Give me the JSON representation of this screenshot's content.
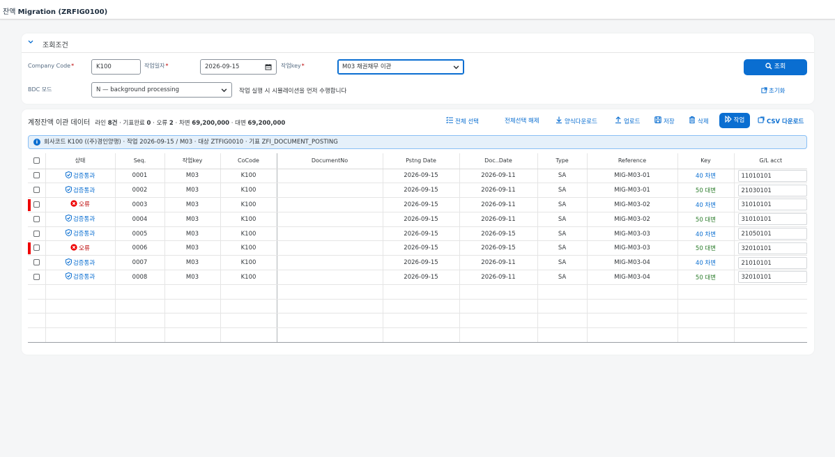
{
  "app": {
    "title_prefix": "잔액",
    "title_main": "Migration (ZRFIG0100)"
  },
  "filter": {
    "header": "조회조건",
    "company_code_label": "Company Code",
    "company_code_value": "K100",
    "date_label": "작업일자",
    "date_value": "2026-09-15",
    "key_label": "작업key",
    "key_value": "M03 채권채무 이관",
    "bdc_label": "BDC 모드",
    "bdc_value": "N — background processing",
    "hint": "작업 실행 시 시뮬레이션을 먼저 수행합니다",
    "search_label": "조회",
    "reset_label": "초기화"
  },
  "table": {
    "title": "계정잔액 이관 데이터",
    "summary": {
      "lines_label": "라인",
      "lines_value": "8건",
      "posted_label": "· 기표완료",
      "posted_value": "0",
      "error_label": "· 오류",
      "error_value": "2",
      "debit_label": "· 차변",
      "debit_value": "69,200,000",
      "credit_label": "· 대변",
      "credit_value": "69,200,000"
    },
    "toolbar": {
      "select_all": "전체 선택",
      "deselect_all": "전체선택 해제",
      "template_download": "양식다운로드",
      "upload": "업로드",
      "save": "저장",
      "delete": "삭제",
      "run": "작업",
      "csv_download": "CSV 다운로드"
    },
    "info": "회사코드 K100 ((주)경인양행) · 작업 2026-09-15 / M03 · 대상 ZTFIG0010 · 기표 ZFI_DOCUMENT_POSTING",
    "columns": [
      "상태",
      "Seq.",
      "작업key",
      "CoCode",
      "DocumentNo",
      "Pstng Date",
      "Doc..Date",
      "Type",
      "Reference",
      "Key",
      "G/L acct"
    ],
    "rows": [
      {
        "status": "검증통과",
        "ok": true,
        "seq": "0001",
        "key": "M03",
        "cocode": "K100",
        "docno": "",
        "pdate": "2026-09-15",
        "ddate": "2026-09-11",
        "type": "SA",
        "ref": "MIG-M03-01",
        "pkey": "40 차변",
        "debit": true,
        "gl": "11010101"
      },
      {
        "status": "검증통과",
        "ok": true,
        "seq": "0002",
        "key": "M03",
        "cocode": "K100",
        "docno": "",
        "pdate": "2026-09-15",
        "ddate": "2026-09-11",
        "type": "SA",
        "ref": "MIG-M03-01",
        "pkey": "50 대변",
        "debit": false,
        "gl": "21030101"
      },
      {
        "status": "오류",
        "ok": false,
        "seq": "0003",
        "key": "M03",
        "cocode": "K100",
        "docno": "",
        "pdate": "2026-09-15",
        "ddate": "2026-09-11",
        "type": "SA",
        "ref": "MIG-M03-02",
        "pkey": "40 차변",
        "debit": true,
        "gl": "31010101"
      },
      {
        "status": "검증통과",
        "ok": true,
        "seq": "0004",
        "key": "M03",
        "cocode": "K100",
        "docno": "",
        "pdate": "2026-09-15",
        "ddate": "2026-09-11",
        "type": "SA",
        "ref": "MIG-M03-02",
        "pkey": "50 대변",
        "debit": false,
        "gl": "31010101"
      },
      {
        "status": "검증통과",
        "ok": true,
        "seq": "0005",
        "key": "M03",
        "cocode": "K100",
        "docno": "",
        "pdate": "2026-09-15",
        "ddate": "2026-09-15",
        "type": "SA",
        "ref": "MIG-M03-03",
        "pkey": "40 차변",
        "debit": true,
        "gl": "21050101"
      },
      {
        "status": "오류",
        "ok": false,
        "seq": "0006",
        "key": "M03",
        "cocode": "K100",
        "docno": "",
        "pdate": "2026-09-15",
        "ddate": "2026-09-15",
        "type": "SA",
        "ref": "MIG-M03-03",
        "pkey": "50 대변",
        "debit": false,
        "gl": "32010101"
      },
      {
        "status": "검증통과",
        "ok": true,
        "seq": "0007",
        "key": "M03",
        "cocode": "K100",
        "docno": "",
        "pdate": "2026-09-15",
        "ddate": "2026-09-11",
        "type": "SA",
        "ref": "MIG-M03-04",
        "pkey": "40 차변",
        "debit": true,
        "gl": "21010101"
      },
      {
        "status": "검증통과",
        "ok": true,
        "seq": "0008",
        "key": "M03",
        "cocode": "K100",
        "docno": "",
        "pdate": "2026-09-15",
        "ddate": "2026-09-11",
        "type": "SA",
        "ref": "MIG-M03-04",
        "pkey": "50 대변",
        "debit": false,
        "gl": "32010101"
      }
    ],
    "empty_rows": 4
  }
}
